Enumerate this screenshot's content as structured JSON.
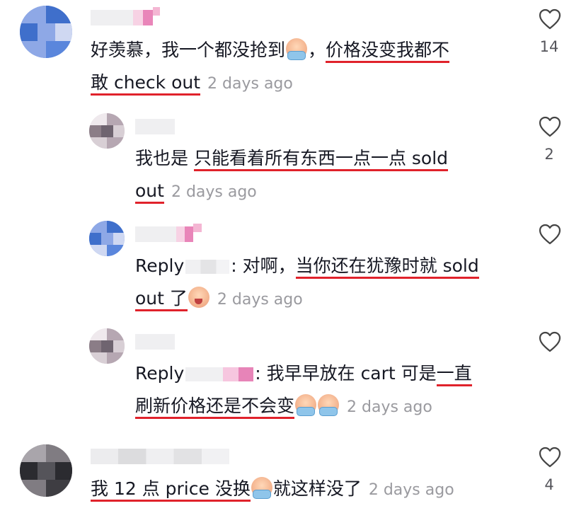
{
  "comments": [
    {
      "text_lead": "好羡慕，我一个都没抢到",
      "text_sep": "，",
      "text_ul1": "价格没变我都不",
      "text_ul2": "敢 check out",
      "time": "2 days ago",
      "likes": "14",
      "avatar_colors": [
        "#3f6fcb",
        "#5a86dc",
        "#8ea8e6",
        "#cfd8f2"
      ],
      "emoji": "crying-face-icon"
    },
    {
      "text_lead": "我也是 ",
      "text_ul1": "只能看着所有东西一点一点 sold",
      "text_ul2": "out",
      "time": "2 days ago",
      "likes": "2",
      "avatar_colors": [
        "#8b7d87",
        "#b6a7b2",
        "#d8cfd5",
        "#efe9ed"
      ]
    },
    {
      "reply_prefix": "Reply",
      "text_colon": ": 对啊，",
      "text_ul1": "当你还在犹豫时就 sold",
      "text_ul2": "out 了",
      "time": "2 days ago",
      "avatar_colors": [
        "#3f6fcb",
        "#5a86dc",
        "#8ea8e6",
        "#cfd8f2"
      ],
      "emoji": "crying-face-icon"
    },
    {
      "reply_prefix": "Reply",
      "text_colon": ": 我早早放在 cart 可是",
      "text_ul1": "一直",
      "text_ul2": "刷新价格还是不会变",
      "time": "2 days ago",
      "avatar_colors": [
        "#8b7d87",
        "#b6a7b2",
        "#d8cfd5",
        "#efe9ed"
      ],
      "emoji": "crying-face-icon"
    },
    {
      "text_ul1": "我 12 点 price 没换",
      "text_tail": "就这样没了",
      "time": "2 days ago",
      "likes": "4",
      "avatar_colors": [
        "#2b2b30",
        "#55545a",
        "#807c82",
        "#a9a5ab"
      ],
      "emoji": "crying-face-icon"
    }
  ]
}
